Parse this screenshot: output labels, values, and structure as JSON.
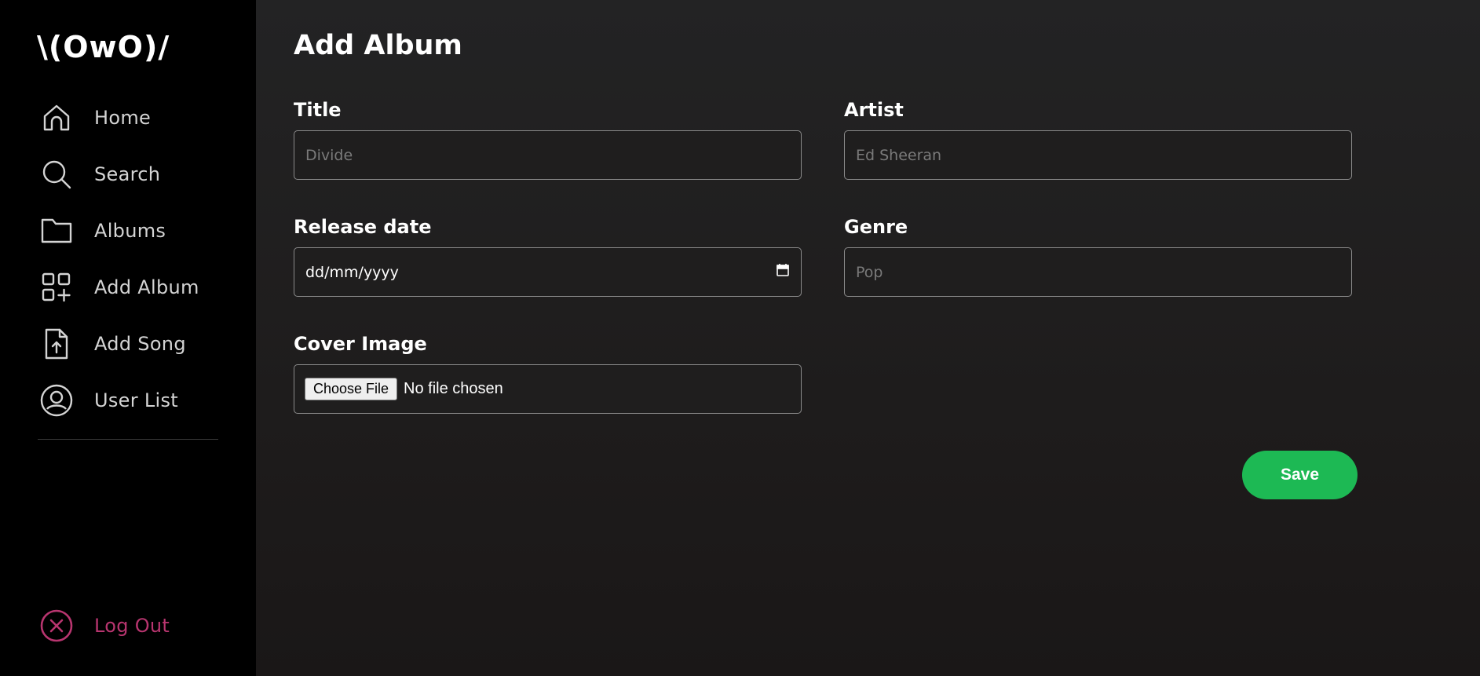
{
  "app": {
    "logo": "\\(OwO)/"
  },
  "sidebar": {
    "items": [
      {
        "label": "Home",
        "icon": "home-icon"
      },
      {
        "label": "Search",
        "icon": "search-icon"
      },
      {
        "label": "Albums",
        "icon": "folder-icon"
      },
      {
        "label": "Add Album",
        "icon": "add-grid-icon"
      },
      {
        "label": "Add Song",
        "icon": "file-upload-icon"
      },
      {
        "label": "User List",
        "icon": "user-circle-icon"
      }
    ],
    "logout": {
      "label": "Log Out",
      "icon": "close-circle-icon"
    }
  },
  "form": {
    "title": "Add Album",
    "title_field": {
      "label": "Title",
      "placeholder": "Divide",
      "value": ""
    },
    "artist_field": {
      "label": "Artist",
      "placeholder": "Ed Sheeran",
      "value": ""
    },
    "release_date_field": {
      "label": "Release date",
      "display": "dd/mm/yyyy"
    },
    "genre_field": {
      "label": "Genre",
      "placeholder": "Pop",
      "value": ""
    },
    "cover_field": {
      "label": "Cover Image",
      "button": "Choose File",
      "status": "No file chosen"
    },
    "save_label": "Save"
  },
  "colors": {
    "sidebar_bg": "#000000",
    "main_bg": "#222222",
    "text_primary": "#ffffff",
    "nav_text": "#d4d4d4",
    "logout": "#b8356f",
    "save_button": "#1db954"
  }
}
